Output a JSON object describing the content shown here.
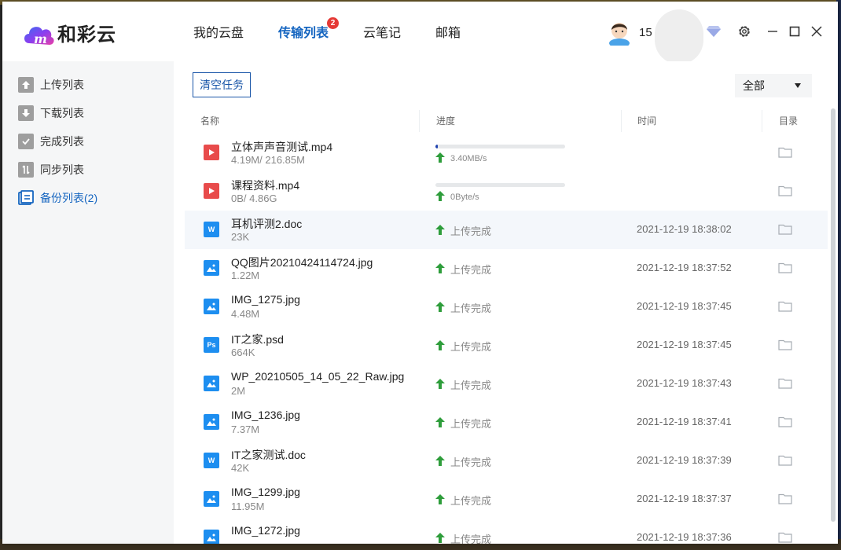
{
  "app": {
    "logo_text": "和彩云",
    "brand_color": "#7b3fe4",
    "accent_color": "#1565c0"
  },
  "nav": {
    "tabs": [
      {
        "label": "我的云盘"
      },
      {
        "label": "传输列表",
        "badge": "2"
      },
      {
        "label": "云笔记"
      },
      {
        "label": "邮箱"
      }
    ],
    "active_tab": "传输列表"
  },
  "user": {
    "name_partial": "15",
    "avatar_icon": "avatar-icon",
    "vip_icon": "diamond-icon"
  },
  "window_controls": {
    "settings_icon": "gear-icon",
    "minimize_icon": "minimize-icon",
    "maximize_icon": "maximize-icon",
    "close_icon": "close-icon"
  },
  "sidebar": {
    "items": [
      {
        "label": "上传列表",
        "icon": "upload-list-icon"
      },
      {
        "label": "下载列表",
        "icon": "download-list-icon"
      },
      {
        "label": "完成列表",
        "icon": "completed-list-icon"
      },
      {
        "label": "同步列表",
        "icon": "sync-list-icon"
      },
      {
        "label": "备份列表(2)",
        "icon": "backup-list-icon"
      }
    ],
    "active_index": 4
  },
  "toolbar": {
    "clear_label": "清空任务",
    "filter_value": "全部"
  },
  "table": {
    "headers": {
      "name": "名称",
      "progress": "进度",
      "time": "时间",
      "folder": "目录"
    },
    "rows": [
      {
        "name": "立体声声音测试.mp4",
        "size": "4.19M/ 216.85M",
        "type": "video",
        "progress": 0.02,
        "speed": "3.40MB/s",
        "status": "",
        "time": ""
      },
      {
        "name": "课程资料.mp4",
        "size": "0B/ 4.86G",
        "type": "video",
        "progress": 0,
        "speed": "0Byte/s",
        "status": "",
        "time": ""
      },
      {
        "name": "耳机评测2.doc",
        "size": "23K",
        "type": "doc",
        "status": "上传完成",
        "time": "2021-12-19 18:38:02"
      },
      {
        "name": "QQ图片20210424114724.jpg",
        "size": "1.22M",
        "type": "image",
        "status": "上传完成",
        "time": "2021-12-19 18:37:52"
      },
      {
        "name": "IMG_1275.jpg",
        "size": "4.48M",
        "type": "image",
        "status": "上传完成",
        "time": "2021-12-19 18:37:45"
      },
      {
        "name": "IT之家.psd",
        "size": "664K",
        "type": "psd",
        "status": "上传完成",
        "time": "2021-12-19 18:37:45"
      },
      {
        "name": "WP_20210505_14_05_22_Raw.jpg",
        "size": "2M",
        "type": "image",
        "status": "上传完成",
        "time": "2021-12-19 18:37:43"
      },
      {
        "name": "IMG_1236.jpg",
        "size": "7.37M",
        "type": "image",
        "status": "上传完成",
        "time": "2021-12-19 18:37:41"
      },
      {
        "name": "IT之家测试.doc",
        "size": "42K",
        "type": "doc",
        "status": "上传完成",
        "time": "2021-12-19 18:37:39"
      },
      {
        "name": "IMG_1299.jpg",
        "size": "11.95M",
        "type": "image",
        "status": "上传完成",
        "time": "2021-12-19 18:37:37"
      },
      {
        "name": "IMG_1272.jpg",
        "size": "",
        "type": "image",
        "status": "上传完成",
        "time": "2021-12-19 18:37:36"
      }
    ],
    "highlighted_row": 2
  },
  "icon_glyphs": {
    "doc": "W",
    "psd": "Ps"
  },
  "colors": {
    "video": "#e84b4b",
    "doc": "#1d8ef0",
    "image": "#1d8ef0",
    "psd": "#1d8ef0",
    "upload_arrow": "#2e9d3b",
    "progress": "#1e40af"
  }
}
